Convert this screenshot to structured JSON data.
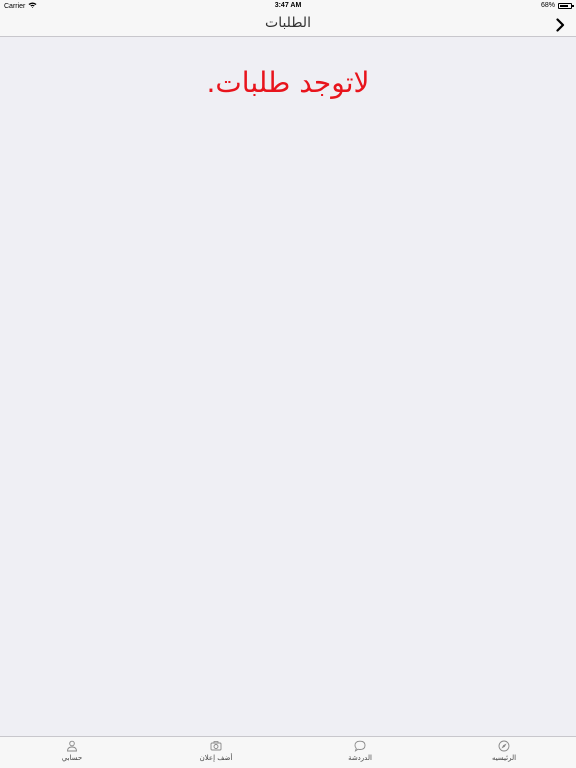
{
  "status_bar": {
    "carrier": "Carrier",
    "time": "3:47 AM",
    "battery": "68%"
  },
  "nav": {
    "title": "الطلبات"
  },
  "content": {
    "empty_message": "لاتوجد طلبات."
  },
  "tabs": [
    {
      "label": "حسابي",
      "icon": "person-icon"
    },
    {
      "label": "أضف إعلان",
      "icon": "camera-icon"
    },
    {
      "label": "الدردشة",
      "icon": "chat-bubble-icon"
    },
    {
      "label": "الرئيسيه",
      "icon": "compass-icon"
    }
  ],
  "colors": {
    "accent_red": "#e8141c",
    "background": "#efeff4",
    "bar": "#f7f7f7"
  }
}
